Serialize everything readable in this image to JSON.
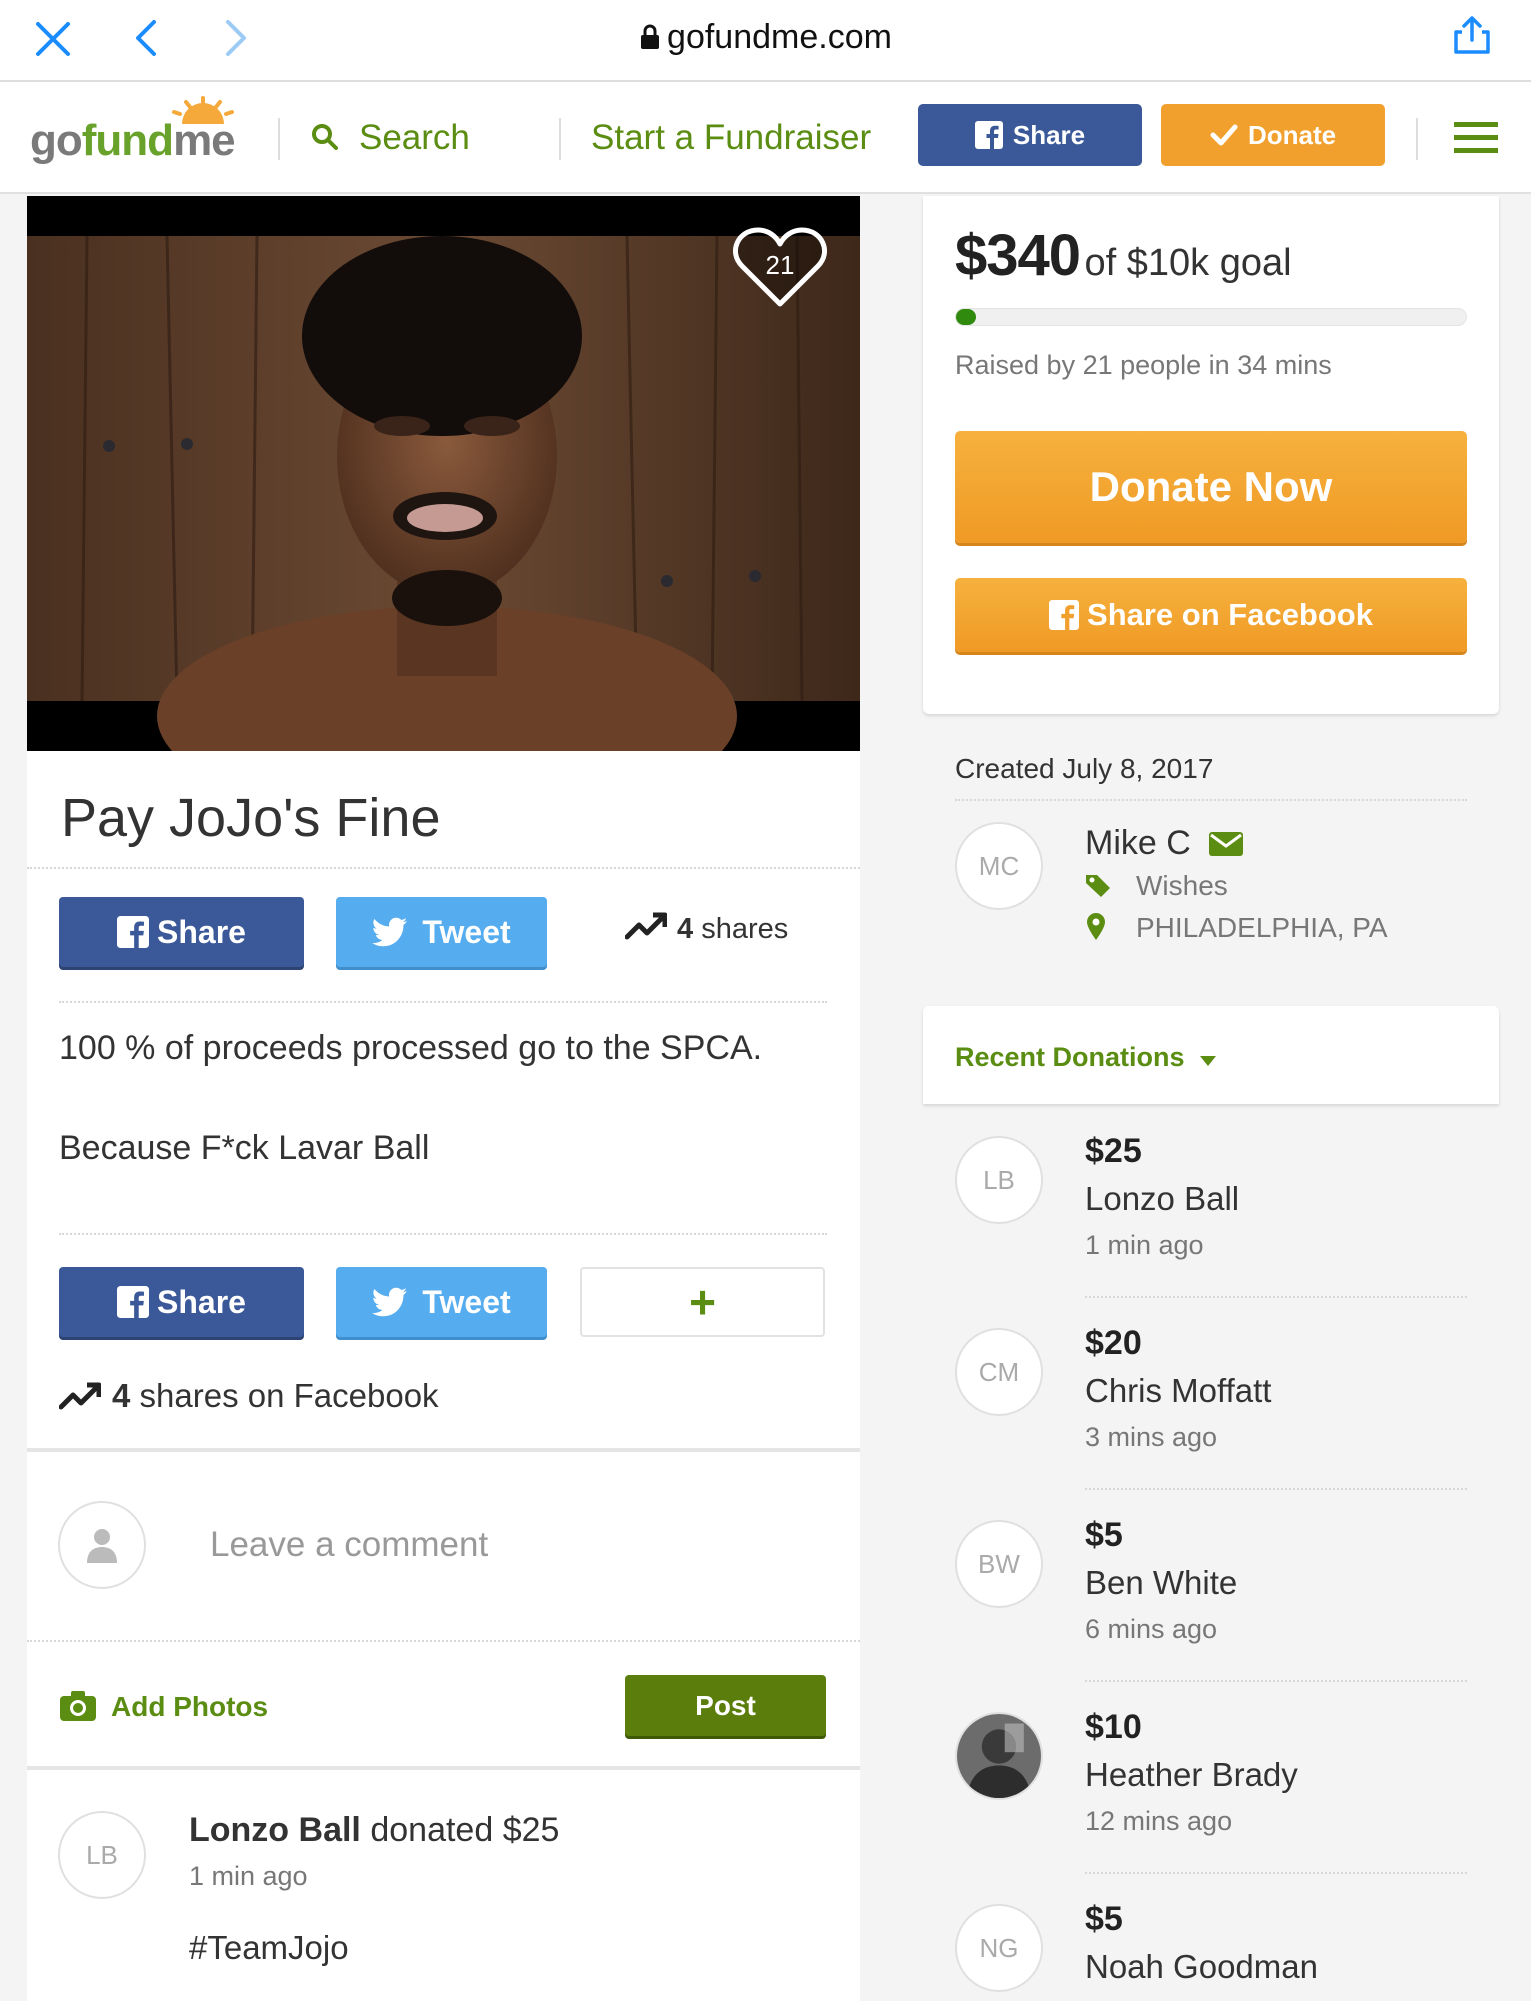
{
  "browser": {
    "url": "gofundme.com"
  },
  "header": {
    "logo_part1": "go",
    "logo_part2": "fund",
    "logo_part3": "me",
    "search_label": "Search",
    "start_label": "Start a Fundraiser",
    "share_label": "Share",
    "donate_label": "Donate"
  },
  "campaign": {
    "heart_count": "21",
    "title": "Pay JoJo's Fine",
    "share_label": "Share",
    "tweet_label": "Tweet",
    "shares_count": "4",
    "shares_word": "shares",
    "description_line1": "100 % of proceeds processed go to the SPCA.",
    "description_line2": "Because F*ck Lavar Ball",
    "plus_label": "+",
    "fb_shares_count": "4",
    "fb_shares_text": "shares on Facebook"
  },
  "comment_box": {
    "placeholder": "Leave a comment",
    "add_photos_label": "Add Photos",
    "post_label": "Post"
  },
  "feed": {
    "initials": "LB",
    "name": "Lonzo Ball",
    "action": "donated $25",
    "time": "1 min ago",
    "message": "#TeamJojo"
  },
  "progress": {
    "raised": "$340",
    "goal_text": "of $10k goal",
    "fraction": 0.034,
    "raised_by": "Raised by 21 people in 34 mins",
    "donate_now_label": "Donate Now",
    "share_fb_label": "Share on Facebook"
  },
  "organizer": {
    "created": "Created July 8, 2017",
    "initials": "MC",
    "name": "Mike C",
    "category": "Wishes",
    "location": "PHILADELPHIA, PA"
  },
  "recent": {
    "header": "Recent Donations",
    "donations": [
      {
        "initials": "LB",
        "amount": "$25",
        "name": "Lonzo Ball",
        "time": "1 min ago"
      },
      {
        "initials": "CM",
        "amount": "$20",
        "name": "Chris Moffatt",
        "time": "3 mins ago"
      },
      {
        "initials": "BW",
        "amount": "$5",
        "name": "Ben White",
        "time": "6 mins ago"
      },
      {
        "initials": "",
        "amount": "$10",
        "name": "Heather Brady",
        "time": "12 mins ago"
      },
      {
        "initials": "NG",
        "amount": "$5",
        "name": "Noah Goodman",
        "time": ""
      }
    ]
  },
  "colors": {
    "brand_green": "#5a8d12",
    "facebook_blue": "#3b5998",
    "twitter_blue": "#55acee",
    "orange": "#f1a02d",
    "ios_blue": "#1a8cff"
  }
}
